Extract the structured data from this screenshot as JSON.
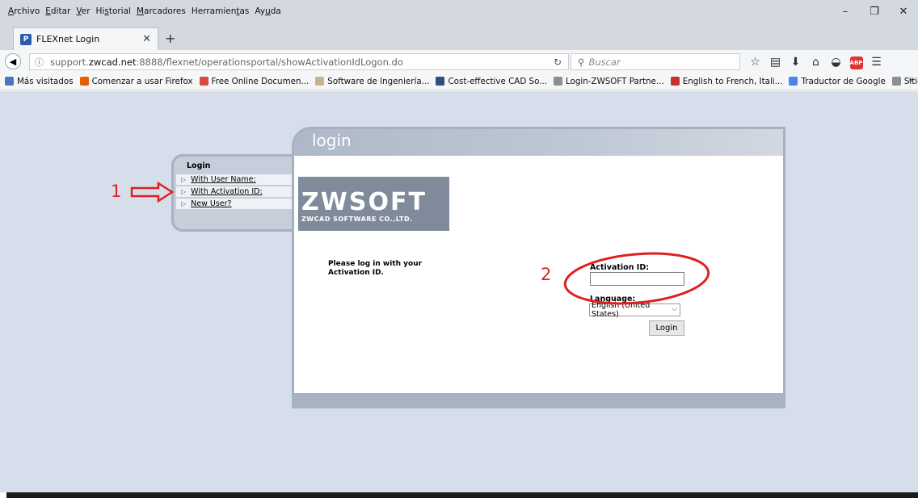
{
  "menubar": {
    "items": [
      {
        "pre": "",
        "u": "A",
        "post": "rchivo"
      },
      {
        "pre": "",
        "u": "E",
        "post": "ditar"
      },
      {
        "pre": "",
        "u": "V",
        "post": "er"
      },
      {
        "pre": "Hi",
        "u": "s",
        "post": "torial"
      },
      {
        "pre": "",
        "u": "M",
        "post": "arcadores"
      },
      {
        "pre": "Herramien",
        "u": "t",
        "post": "as"
      },
      {
        "pre": "Ay",
        "u": "u",
        "post": "da"
      }
    ],
    "window_controls": [
      "–",
      "❐",
      "✕"
    ]
  },
  "tab": {
    "title": "FLEXnet Login",
    "favicon": "P",
    "close": "✕",
    "new_tab": "+"
  },
  "navbar": {
    "url_prefix": "support.",
    "url_domain": "zwcad.net",
    "url_suffix": ":8888/flexnet/operationsportal/showActivationIdLogon.do",
    "search_placeholder": "Buscar"
  },
  "bookmarks": [
    {
      "label": "Más visitados",
      "color": "#4a78c0"
    },
    {
      "label": "Comenzar a usar Firefox",
      "color": "#e66000"
    },
    {
      "label": "Free Online Documen...",
      "color": "#d94a3a"
    },
    {
      "label": "Software de Ingeniería...",
      "color": "#c9b48a"
    },
    {
      "label": "Cost-effective CAD So...",
      "color": "#2c4f7c"
    },
    {
      "label": "Login-ZWSOFT Partne...",
      "color": "#8a8f96"
    },
    {
      "label": "English to French, Itali...",
      "color": "#c5322a"
    },
    {
      "label": "Traductor de Google",
      "color": "#4a86e8"
    },
    {
      "label": "Sitios sugeridos",
      "color": "#8a8f96"
    }
  ],
  "left_menu": {
    "title": "Login",
    "items": [
      "With User Name:",
      "With Activation ID:",
      "New User?"
    ]
  },
  "card": {
    "header_title": "login",
    "logo_main": "ZWSOFT",
    "logo_sub": "ZWCAD SOFTWARE CO.,LTD.",
    "instruction": "Please log in with your Activation ID.",
    "activation_label": "Activation ID:",
    "activation_value": "",
    "language_label": "Language:",
    "language_value": "English (United States)",
    "login_button": "Login"
  },
  "annotations": {
    "num1": "1",
    "num2": "2",
    "color": "#e02020"
  }
}
